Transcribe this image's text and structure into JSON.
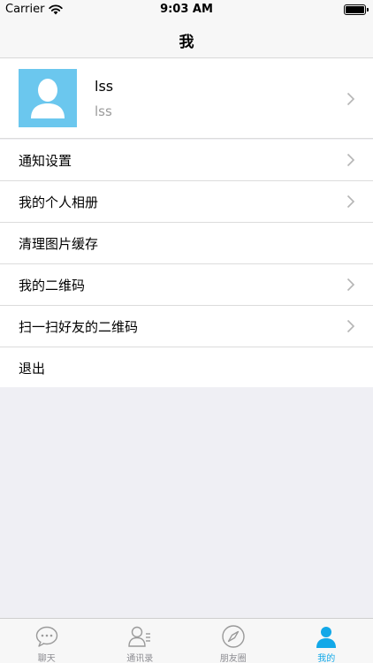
{
  "status_bar": {
    "carrier": "Carrier",
    "time": "9:03 AM"
  },
  "nav": {
    "title": "我"
  },
  "profile": {
    "name": "lss",
    "account": "lss"
  },
  "menu": [
    {
      "label": "通知设置",
      "chevron": true
    },
    {
      "label": "我的个人相册",
      "chevron": true
    },
    {
      "label": "清理图片缓存",
      "chevron": false
    },
    {
      "label": "我的二维码",
      "chevron": true
    },
    {
      "label": "扫一扫好友的二维码",
      "chevron": true
    },
    {
      "label": "退出",
      "chevron": false
    }
  ],
  "tabs": [
    {
      "label": "聊天",
      "icon": "chat-bubble-icon",
      "active": false
    },
    {
      "label": "通讯录",
      "icon": "contacts-icon",
      "active": false
    },
    {
      "label": "朋友圈",
      "icon": "compass-icon",
      "active": false
    },
    {
      "label": "我的",
      "icon": "person-icon",
      "active": true
    }
  ],
  "colors": {
    "accent": "#12a8e8",
    "avatar_bg": "#6bc7ee",
    "background": "#efeff4"
  }
}
